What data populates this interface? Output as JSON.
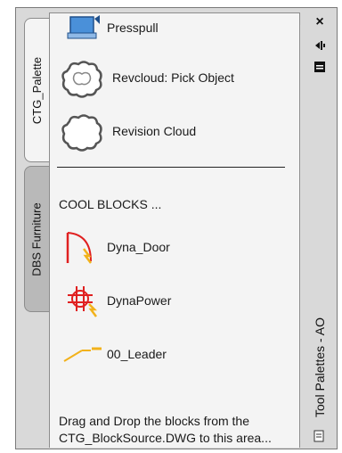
{
  "tabs": [
    {
      "label": "CTG_Palette",
      "active": true
    },
    {
      "label": "DBS Furniture",
      "active": false
    }
  ],
  "palette": {
    "items_top": [
      {
        "label": "Presspull",
        "icon": "presspull-icon"
      },
      {
        "label": "Revcloud: Pick Object",
        "icon": "revcloud-icon"
      },
      {
        "label": "Revision Cloud",
        "icon": "revision-cloud-icon"
      }
    ],
    "group_title": "COOL BLOCKS ...",
    "items_blocks": [
      {
        "label": "Dyna_Door",
        "icon": "dynamic-door-block-icon"
      },
      {
        "label": "DynaPower",
        "icon": "dynamic-power-block-icon"
      },
      {
        "label": "00_Leader",
        "icon": "leader-block-icon"
      }
    ],
    "hint": "Drag and Drop the blocks from the CTG_BlockSource.DWG to this area..."
  },
  "window": {
    "title": "Tool Palettes - AO",
    "close_glyph": "×",
    "buttons": [
      "close-icon",
      "auto-hide-icon",
      "properties-icon"
    ]
  },
  "colors": {
    "accent_red": "#e02020",
    "accent_yellow": "#f2b21b"
  }
}
